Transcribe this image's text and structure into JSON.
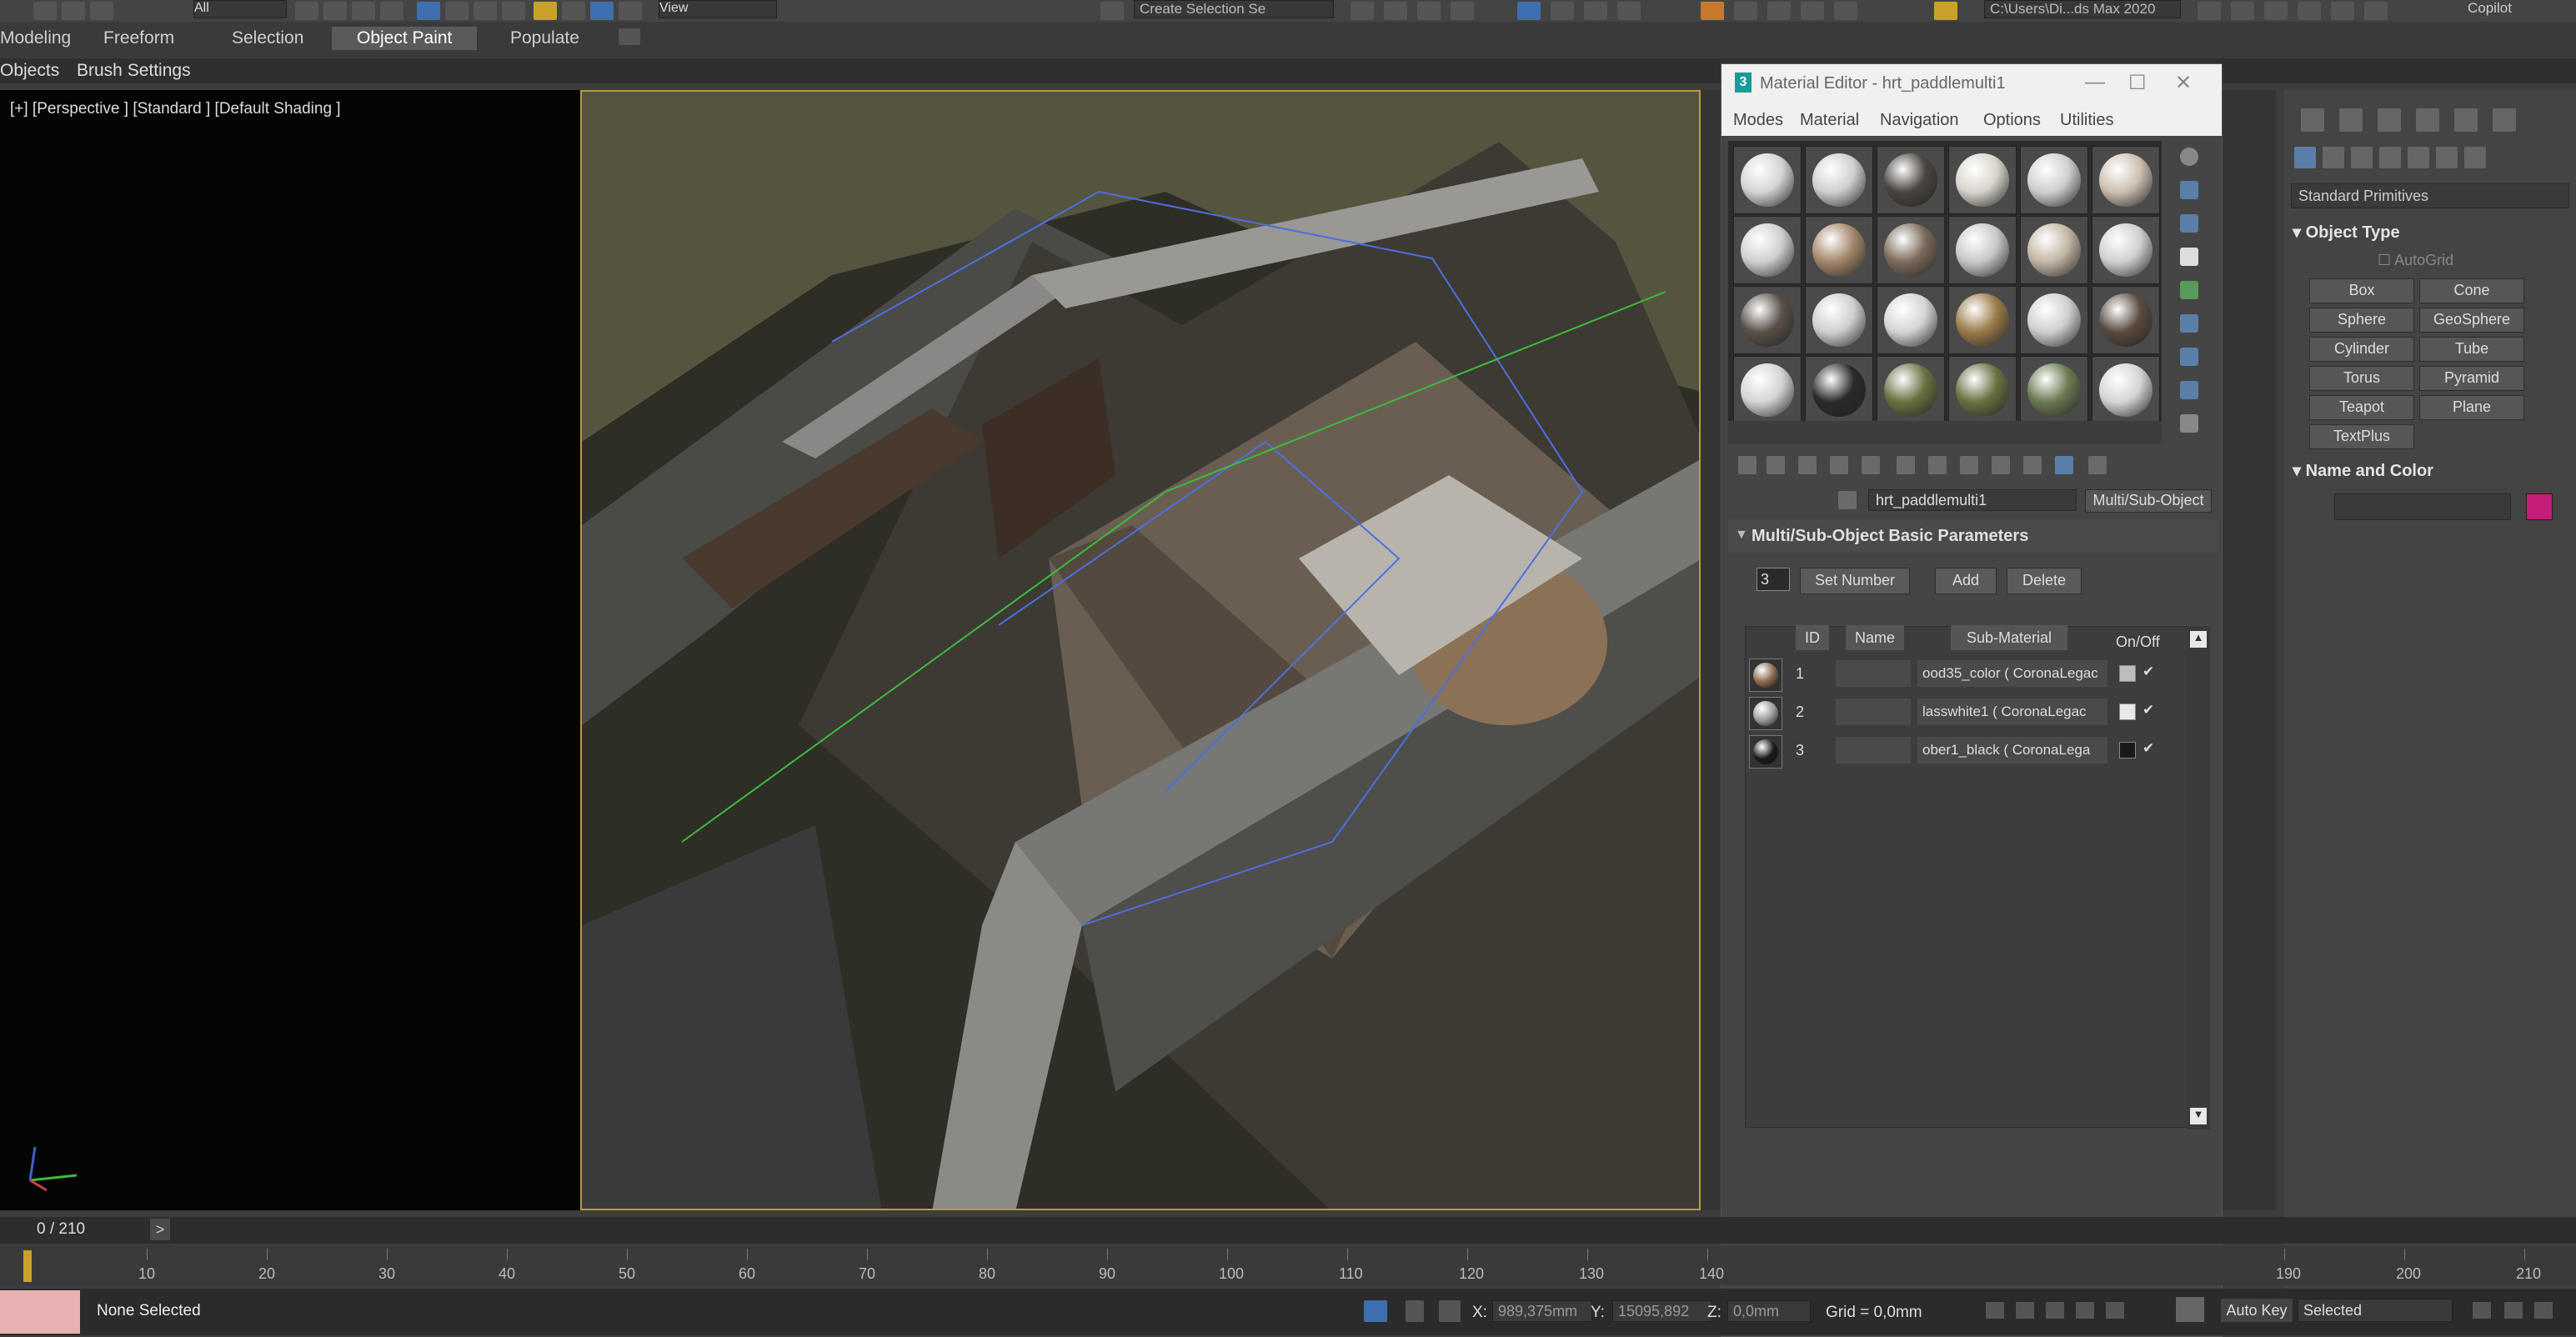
{
  "toolbar": {
    "selection_set_placeholder": "Create Selection Se",
    "filter_value": "All",
    "view_value": "View",
    "project_path": "C:\\Users\\Di...ds Max 2020",
    "copilot_label": "Copilot"
  },
  "ribbon": {
    "tabs": [
      "Modeling",
      "Freeform",
      "Selection",
      "Object Paint",
      "Populate"
    ],
    "active_tab": "Object Paint",
    "subtabs": [
      "Objects",
      "Brush Settings"
    ]
  },
  "viewport": {
    "label": "[+] [Perspective ] [Standard ] [Default Shading ]"
  },
  "material_editor": {
    "title": "Material Editor - hrt_paddlemulti1",
    "menu": [
      "Modes",
      "Material",
      "Navigation",
      "Options",
      "Utilities"
    ],
    "slot_colors": [
      "#d4d4d4",
      "#cfcfcf",
      "#4a4540",
      "#d8d4cc",
      "#cfcfcf",
      "#cbbfb0",
      "#cfcfcf",
      "#a4866a",
      "#7b6a5a",
      "#c8c8c8",
      "#c2b6a4",
      "#cfcfcf",
      "#5a5048",
      "#cfcfcf",
      "#d4d4d4",
      "#9a7a4a",
      "#cfcfcf",
      "#5a4a3e",
      "#d4d4d4",
      "#2a2a2a",
      "#6a7040",
      "#6a7040",
      "#6a7a50",
      "#d4d4d4"
    ],
    "material_name": "hrt_paddlemulti1",
    "material_type": "Multi/Sub-Object",
    "rollout_title": "Multi/Sub-Object Basic Parameters",
    "num_value": "3",
    "set_number_label": "Set Number",
    "add_label": "Add",
    "delete_label": "Delete",
    "headers": {
      "id": "ID",
      "name": "Name",
      "sub_material": "Sub-Material",
      "onoff": "On/Off"
    },
    "rows": [
      {
        "id": "1",
        "sub": "ood35_color ( CoronaLegac",
        "ball": "#8a6a4e",
        "clr": "#bdbdbd",
        "check": "✔"
      },
      {
        "id": "2",
        "sub": "lasswhite1 ( CoronaLegac",
        "ball": "#9a9a9a",
        "clr": "#e8e8e8",
        "check": "✔"
      },
      {
        "id": "3",
        "sub": "ober1_black ( CoronaLega",
        "ball": "#1a1a1a",
        "clr": "#1a1a1a",
        "check": "✔"
      }
    ]
  },
  "command_panel": {
    "category": "Standard Primitives",
    "object_type_title": "Object Type",
    "autogrid_label": "AutoGrid",
    "buttons": [
      "Box",
      "Cone",
      "Sphere",
      "GeoSphere",
      "Cylinder",
      "Tube",
      "Torus",
      "Pyramid",
      "Teapot",
      "Plane",
      "TextPlus"
    ],
    "name_color_title": "Name and Color",
    "object_color": "#c41e7a"
  },
  "timeline": {
    "frame_counter": "0 / 210",
    "ticks": [
      "10",
      "20",
      "30",
      "40",
      "50",
      "60",
      "70",
      "80",
      "90",
      "100",
      "110",
      "120",
      "130",
      "140",
      "190",
      "200",
      "210"
    ]
  },
  "status": {
    "selection": "None Selected",
    "x_label": "X:",
    "x_value": "989,375mm",
    "y_label": "Y:",
    "y_value": "15095,892",
    "z_label": "Z:",
    "z_value": "0,0mm",
    "grid": "Grid = 0,0mm",
    "autokey": "Auto Key",
    "key_filter": "Selected"
  }
}
